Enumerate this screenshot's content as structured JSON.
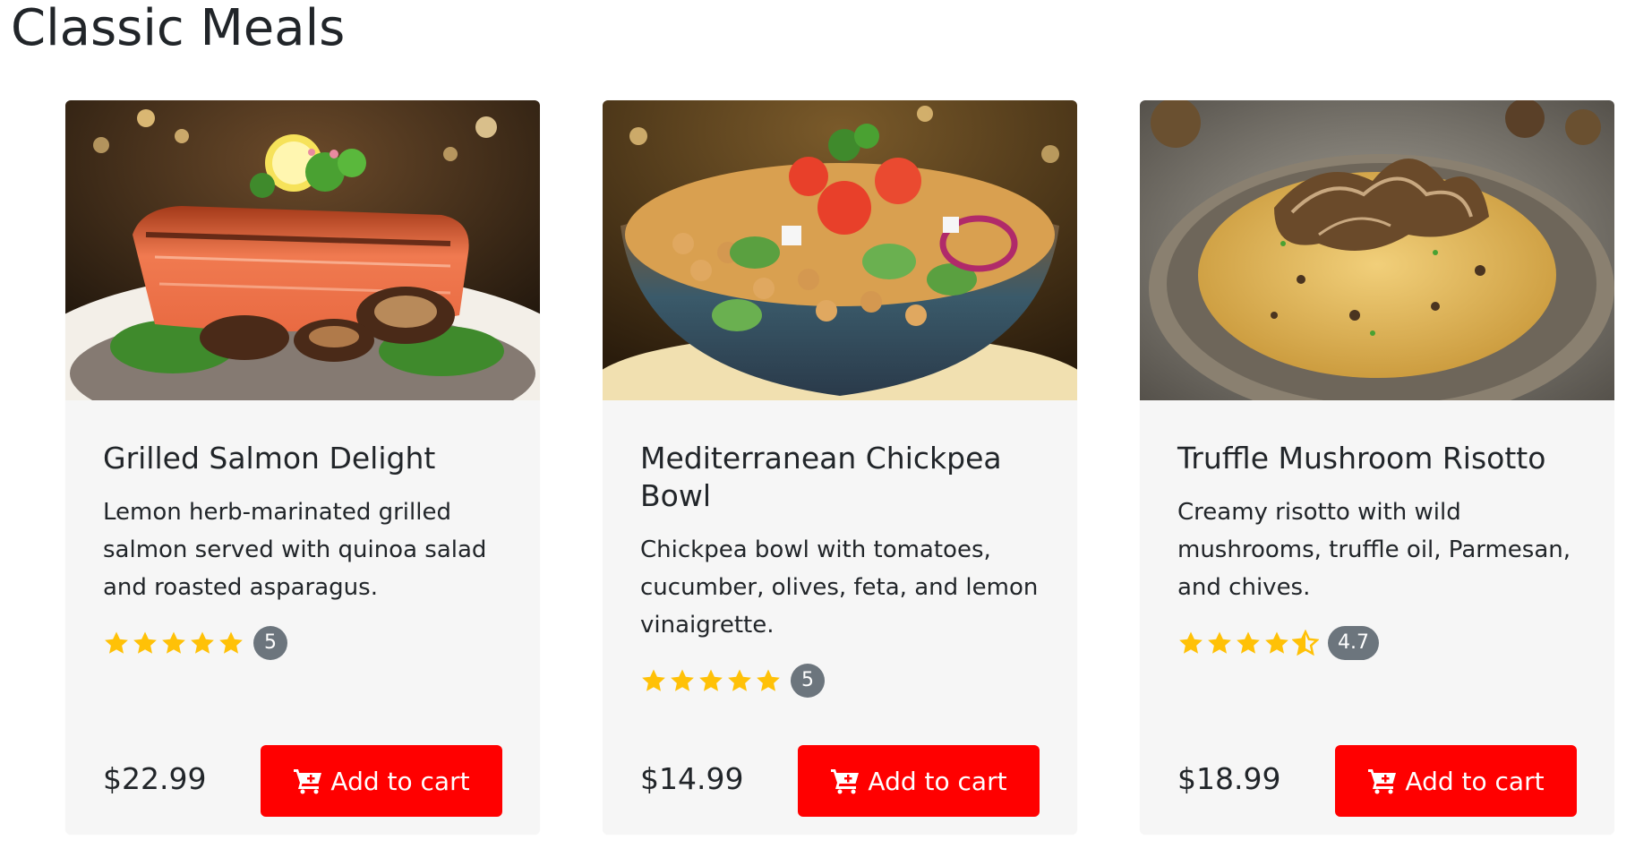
{
  "section": {
    "title": "Classic Meals"
  },
  "colors": {
    "accent": "#ff0000",
    "star": "#ffc107",
    "badge": "#6c757d",
    "card_bg": "#f6f6f6"
  },
  "meals": [
    {
      "title": "Grilled Salmon Delight",
      "description": "Lemon herb-marinated grilled salmon served with quinoa salad and roasted asparagus.",
      "rating": 5,
      "rating_label": "5",
      "price": "$22.99",
      "button_label": "Add to cart",
      "image_icon": "salmon-dish-image"
    },
    {
      "title": "Mediterranean Chickpea Bowl",
      "description": "Chickpea bowl with tomatoes, cucumber, olives, feta, and lemon vinaigrette.",
      "rating": 5,
      "rating_label": "5",
      "price": "$14.99",
      "button_label": "Add to cart",
      "image_icon": "chickpea-bowl-image"
    },
    {
      "title": "Truffle Mushroom Risotto",
      "description": "Creamy risotto with wild mushrooms, truffle oil, Parmesan, and chives.",
      "rating": 4.7,
      "rating_label": "4.7",
      "price": "$18.99",
      "button_label": "Add to cart",
      "image_icon": "risotto-image"
    }
  ]
}
